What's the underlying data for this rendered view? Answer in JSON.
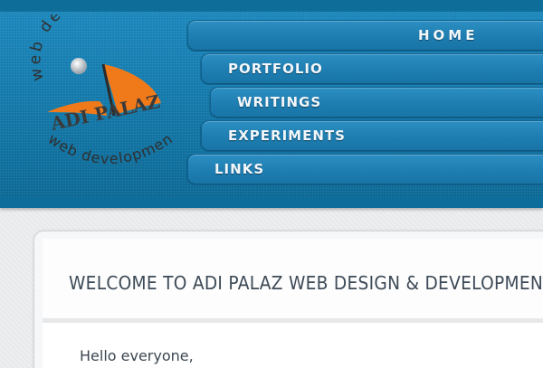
{
  "logo": {
    "top_text": "web design",
    "brand": "ADI PALAZ",
    "bottom_text": "web development",
    "colors": {
      "sail": "#f07a1a",
      "text": "#3a3a3a"
    }
  },
  "nav": {
    "items": [
      {
        "label": "HOME"
      },
      {
        "label": "PORTFOLIO"
      },
      {
        "label": "WRITINGS"
      },
      {
        "label": "EXPERIMENTS"
      },
      {
        "label": "LINKS"
      }
    ]
  },
  "main": {
    "title": "WELCOME TO ADI PALAZ WEB DESIGN & DEVELOPMENT",
    "greeting": "Hello everyone,"
  },
  "colors": {
    "header_blue": "#1279ab",
    "nav_text": "#f2f7fb",
    "title_text": "#3d4a57"
  }
}
